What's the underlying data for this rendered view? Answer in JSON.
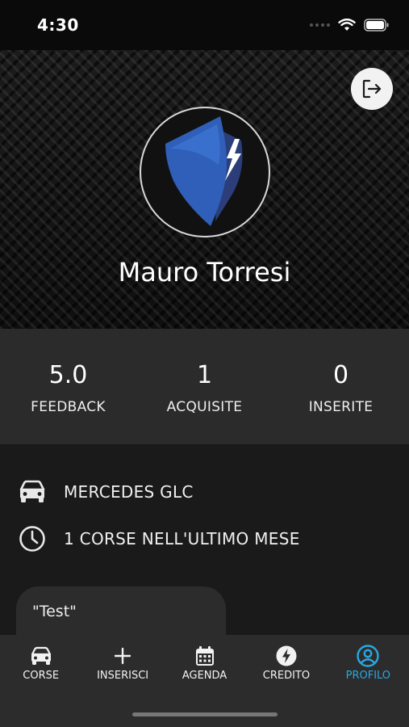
{
  "status_bar": {
    "time": "4:30"
  },
  "profile": {
    "name": "Mauro Torresi"
  },
  "stats": [
    {
      "value": "5.0",
      "label": "FEEDBACK"
    },
    {
      "value": "1",
      "label": "ACQUISITE"
    },
    {
      "value": "0",
      "label": "INSERITE"
    }
  ],
  "info": {
    "car": {
      "icon": "car-icon",
      "text": "MERCEDES GLC"
    },
    "rides": {
      "icon": "clock-icon",
      "text": "1 CORSE NELL'ULTIMO MESE"
    }
  },
  "review": {
    "text": "\"Test\""
  },
  "tabs": [
    {
      "label": "CORSE",
      "icon": "car-icon"
    },
    {
      "label": "INSERISCI",
      "icon": "plus-icon"
    },
    {
      "label": "AGENDA",
      "icon": "calendar-icon"
    },
    {
      "label": "CREDITO",
      "icon": "lightning-icon"
    },
    {
      "label": "PROFILO",
      "icon": "user-circle-icon",
      "active": true
    }
  ],
  "colors": {
    "accent": "#2aa7e0",
    "stats_bg": "#2b2b2b",
    "tab_bg": "#2c2c2c",
    "shield_blue": "#2f5fb8"
  }
}
